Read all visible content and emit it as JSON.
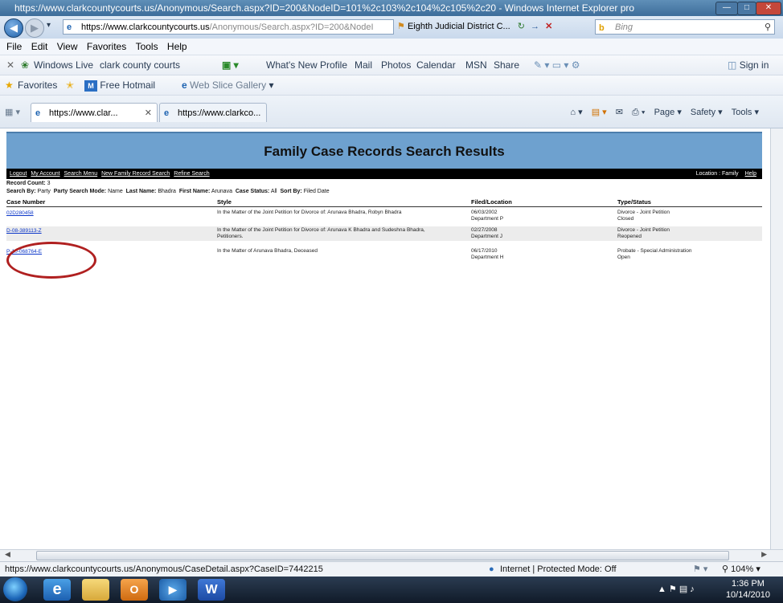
{
  "window": {
    "title": "https://www.clarkcountycourts.us/Anonymous/Search.aspx?ID=200&NodeID=101%2c103%2c104%2c105%2c20 - Windows Internet Explorer pro"
  },
  "address_bar": {
    "url_prefix": "https://",
    "url_domain": "www.clarkcountycourts.us",
    "url_rest": "/Anonymous/Search.aspx?ID=200&NodeI",
    "tab_title": "Eighth Judicial District C...",
    "search_placeholder": "Bing"
  },
  "menu": [
    "File",
    "Edit",
    "View",
    "Favorites",
    "Tools",
    "Help"
  ],
  "live_toolbar": {
    "brand": "Windows Live",
    "search_value": "clark county courts",
    "links": [
      "What's New",
      "Profile",
      "Mail",
      "Photos",
      "Calendar",
      "MSN",
      "Share"
    ],
    "sign_in": "Sign in"
  },
  "favorites_bar": {
    "favorites": "Favorites",
    "hotmail": "Free Hotmail",
    "web_slice": "Web Slice Gallery"
  },
  "tabs": [
    {
      "label": "https://www.clar..."
    },
    {
      "label": "https://www.clarkco..."
    }
  ],
  "command_bar": {
    "page": "Page",
    "safety": "Safety",
    "tools": "Tools"
  },
  "page": {
    "banner_title": "Family Case Records Search Results",
    "nav_links": [
      "Logout",
      "My Account",
      "Search Menu",
      "New Family Record Search",
      "Refine Search"
    ],
    "location_label": "Location : Family",
    "help": "Help",
    "record_count_label": "Record Count:",
    "record_count": "3",
    "search_by_label": "Search By:",
    "search_by": "Party",
    "mode_label": "Party Search Mode:",
    "mode": "Name",
    "last_name_label": "Last Name:",
    "last_name": "Bhadra",
    "first_name_label": "First Name:",
    "first_name": "Arunava",
    "status_label": "Case Status:",
    "status": "All",
    "sort_label": "Sort By:",
    "sort": "Filed Date",
    "columns": [
      "Case Number",
      "Style",
      "Filed/Location",
      "Type/Status"
    ],
    "rows": [
      {
        "case": "02D280458",
        "style_1": "In the Matter of the Joint Petition for Divorce of: Arunava Bhadra, Robyn Bhadra",
        "style_2": "",
        "filed": "06/03/2002",
        "location": "Department P",
        "type": "Divorce - Joint Petition",
        "status": "Closed"
      },
      {
        "case": "D-08-389113-Z",
        "style_1": "In the Matter of the Joint Petition for Divorce of: Arunava K Bhadra and Sudeshna Bhadra,",
        "style_2": "Petitioners.",
        "filed": "02/27/2008",
        "location": "Department J",
        "type": "Divorce - Joint Petition",
        "status": "Reopened"
      },
      {
        "case": "P-10-068764-E",
        "style_1": "In the Matter of Arunava Bhadra, Deceased",
        "style_2": "",
        "filed": "06/17/2010",
        "location": "Department H",
        "type": "Probate - Special Administration",
        "status": "Open"
      }
    ]
  },
  "status_bar": {
    "url": "https://www.clarkcountycourts.us/Anonymous/CaseDetail.aspx?CaseID=7442215",
    "zone": "Internet | Protected Mode: Off",
    "zoom": "104%"
  },
  "taskbar": {
    "time": "1:36 PM",
    "date": "10/14/2010"
  }
}
